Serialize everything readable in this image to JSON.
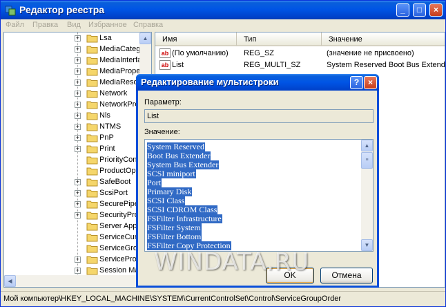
{
  "window": {
    "title": "Редактор реестра"
  },
  "menu": [
    "Файл",
    "Правка",
    "Вид",
    "Избранное",
    "Справка"
  ],
  "tree": {
    "items": [
      {
        "label": "Lsa",
        "expandable": true
      },
      {
        "label": "MediaCateg",
        "expandable": true
      },
      {
        "label": "MediaInterfa",
        "expandable": true
      },
      {
        "label": "MediaPropert",
        "expandable": true
      },
      {
        "label": "MediaResou",
        "expandable": true
      },
      {
        "label": "Network",
        "expandable": true
      },
      {
        "label": "NetworkProv",
        "expandable": true
      },
      {
        "label": "Nls",
        "expandable": true
      },
      {
        "label": "NTMS",
        "expandable": true
      },
      {
        "label": "PnP",
        "expandable": true
      },
      {
        "label": "Print",
        "expandable": true
      },
      {
        "label": "PriorityCont",
        "expandable": false
      },
      {
        "label": "ProductOpti",
        "expandable": false
      },
      {
        "label": "SafeBoot",
        "expandable": true
      },
      {
        "label": "ScsiPort",
        "expandable": true
      },
      {
        "label": "SecurePipe",
        "expandable": true
      },
      {
        "label": "SecurityProv",
        "expandable": true
      },
      {
        "label": "Server Appl",
        "expandable": false
      },
      {
        "label": "ServiceCurr",
        "expandable": false
      },
      {
        "label": "ServiceGrou",
        "expandable": false,
        "selected": true
      },
      {
        "label": "ServiceProv",
        "expandable": true
      },
      {
        "label": "Session Ma",
        "expandable": true
      }
    ]
  },
  "list": {
    "columns": [
      "Имя",
      "Тип",
      "Значение"
    ],
    "rows": [
      {
        "name": "(По умолчанию)",
        "type": "REG_SZ",
        "value": "(значение не присвоено)"
      },
      {
        "name": "List",
        "type": "REG_MULTI_SZ",
        "value": "System Reserved Boot Bus Extender"
      }
    ]
  },
  "status": {
    "path": "Мой компьютер\\HKEY_LOCAL_MACHINE\\SYSTEM\\CurrentControlSet\\Control\\ServiceGroupOrder"
  },
  "dialog": {
    "title": "Редактирование мультистроки",
    "param_label": "Параметр:",
    "param_value": "List",
    "value_label": "Значение:",
    "lines": [
      "System Reserved",
      "Boot Bus Extender",
      "System Bus Extender",
      "SCSI miniport",
      "Port",
      "Primary Disk",
      "SCSI Class",
      "SCSI CDROM Class",
      "FSFilter Infrastructure",
      "FSFilter System",
      "FSFilter Bottom",
      "FSFilter Copy Protection"
    ],
    "ok_label": "OK",
    "cancel_label": "Отмена",
    "help_label": "?",
    "close_label": "×"
  },
  "titlebar_buttons": {
    "minimize": "_",
    "maximize": "□",
    "close": "×"
  },
  "watermark": "WINDATA.RU",
  "colors": {
    "accent": "#0055e5",
    "selection": "#316ac5",
    "face": "#ece9d8"
  }
}
